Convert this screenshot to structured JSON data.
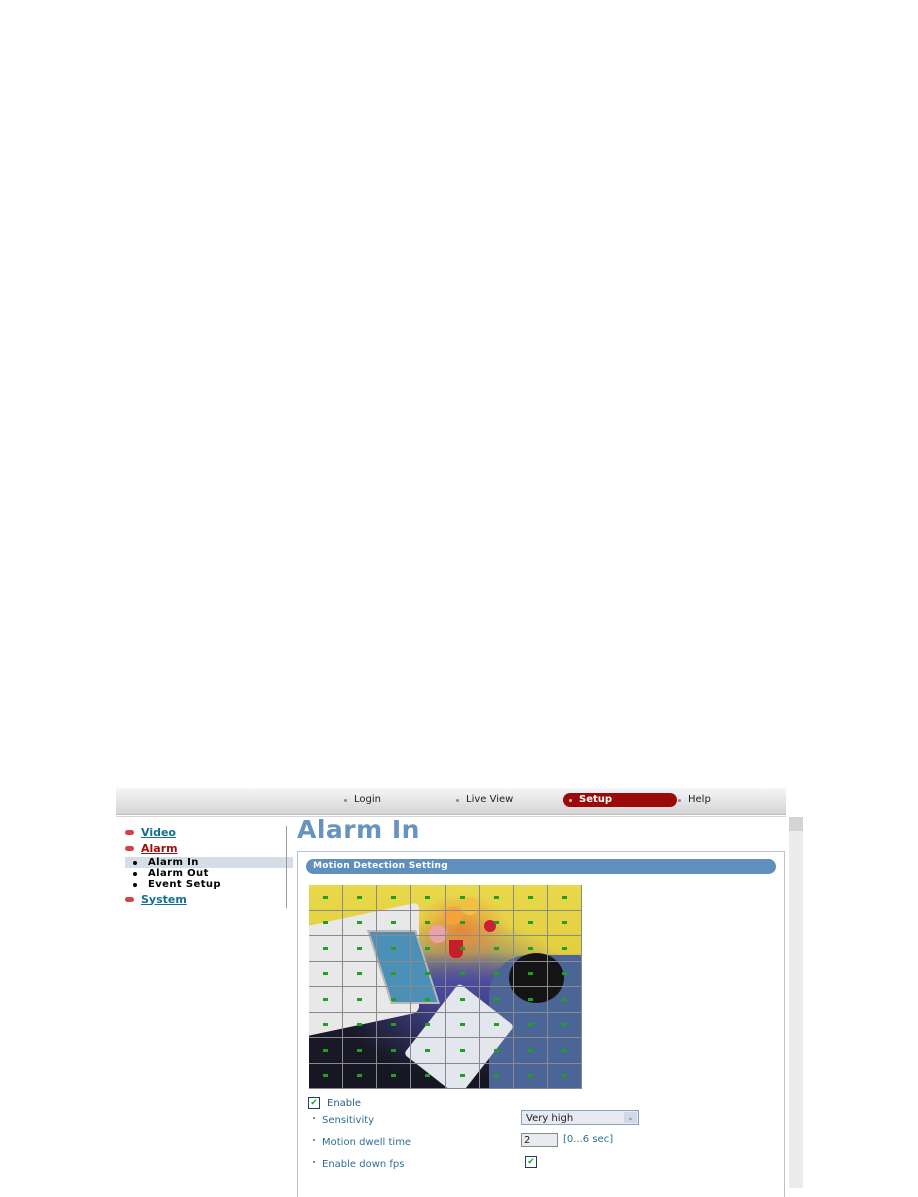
{
  "nav": {
    "items": [
      {
        "label": "Login",
        "active": false
      },
      {
        "label": "Live View",
        "active": false
      },
      {
        "label": "Setup",
        "active": true
      },
      {
        "label": "Help",
        "active": false
      }
    ]
  },
  "sidebar": {
    "sections": [
      {
        "label": "Video"
      },
      {
        "label": "Alarm",
        "expanded": true,
        "children": [
          {
            "label": "Alarm In",
            "selected": true
          },
          {
            "label": "Alarm Out"
          },
          {
            "label": "Event Setup"
          }
        ]
      },
      {
        "label": "System"
      }
    ]
  },
  "main": {
    "title": "Alarm In",
    "panel_title": "Motion Detection Setting",
    "motion_grid": {
      "columns": 8,
      "rows": 8,
      "all_cells_active": true
    },
    "enable": {
      "label": "Enable",
      "checked": true,
      "glyph": "✔"
    },
    "sensitivity": {
      "label": "Sensitivity",
      "value": "Very high",
      "arrow": "⌄"
    },
    "dwell_time": {
      "label": "Motion dwell time",
      "value": "2",
      "hint": "[0...6 sec]"
    },
    "down_fps": {
      "label": "Enable down fps",
      "checked": true,
      "glyph": "✔"
    }
  },
  "colors": {
    "accent_red": "#9a0a0a",
    "title_blue": "#6793bd",
    "panel_header": "#5f8fbd",
    "link_teal": "#136f8f",
    "grid_marker": "#1fa01f"
  }
}
